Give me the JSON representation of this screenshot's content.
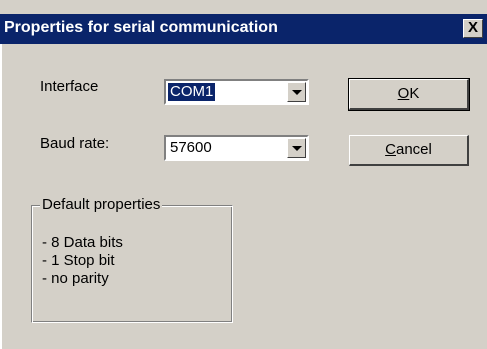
{
  "dialog": {
    "title": "Properties for serial communication",
    "close_glyph": "X"
  },
  "fields": {
    "interface_label": "Interface",
    "interface_value": "COM1",
    "baud_label": "Baud rate:",
    "baud_value": "57600"
  },
  "buttons": {
    "ok_mnemonic": "O",
    "ok_rest": "K",
    "cancel_mnemonic": "C",
    "cancel_rest": "ancel"
  },
  "defaults": {
    "group_label": "Default properties",
    "items": [
      "- 8 Data bits",
      "- 1 Stop bit",
      "- no parity"
    ]
  },
  "colors": {
    "titlebar": "#0a246a",
    "dialog_face": "#d4d0c8",
    "selection": "#0a246a"
  },
  "icons": {
    "dropdown": "chevron-down-icon",
    "close": "close-icon"
  }
}
